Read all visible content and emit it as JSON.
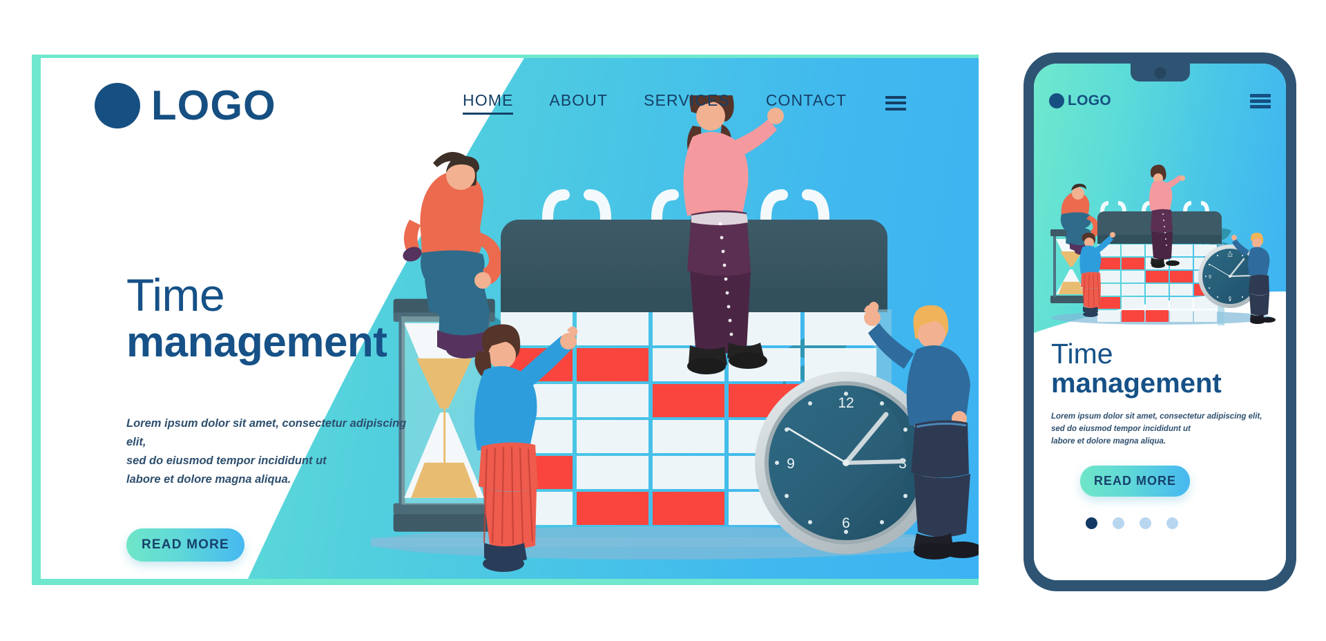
{
  "brand": {
    "logo_text": "LOGO",
    "logo_icon": "circle-dot-icon"
  },
  "nav": {
    "items": [
      {
        "label": "HOME",
        "active": true
      },
      {
        "label": "ABOUT",
        "active": false
      },
      {
        "label": "SERVICES",
        "active": false
      },
      {
        "label": "CONTACT",
        "active": false
      }
    ],
    "menu_icon": "hamburger-icon"
  },
  "hero": {
    "title_line1": "Time",
    "title_line2": "management",
    "description": "Lorem ipsum dolor sit amet, consectetur adipiscing elit,\nsed do eiusmod tempor incididunt ut\nlabore et dolore magna aliqua.",
    "desc_line1": "Lorem ipsum dolor sit amet, consectetur adipiscing elit,",
    "desc_line2": "sed do eiusmod tempor incididunt ut",
    "desc_line3": "labore et dolore magna aliqua.",
    "cta_label": "READ MORE",
    "carousel_dots": 4,
    "carousel_active_index": 0
  },
  "mobile": {
    "logo_text": "LOGO",
    "menu_icon": "hamburger-icon",
    "title_line1": "Time",
    "title_line2": "management",
    "desc_line1": "Lorem ipsum dolor sit amet, consectetur adipiscing elit,",
    "desc_line2": "sed do eiusmod tempor incididunt ut",
    "desc_line3": "labore et dolore magna aliqua.",
    "cta_label": "READ MORE",
    "carousel_dots": 4,
    "carousel_active_index": 0
  },
  "illustration": {
    "clock_numerals": [
      "12",
      "3",
      "6",
      "9"
    ],
    "calendar_columns": 5,
    "calendar_rows": 6,
    "calendar_highlight_color": "#f9453e",
    "calendar_cell_color": "#eef5f8",
    "calendar_header_color": "#3d5a66",
    "hourglass_sand_color": "#e8bd72"
  },
  "colors": {
    "brand_navy": "#164f81",
    "accent_mint": "#6fe8cd",
    "accent_blue": "#3db2f2",
    "frame_border": "#6fe8cd",
    "phone_bezel": "#2f5473",
    "dot_inactive": "#b9d6ef",
    "dot_active": "#123a63"
  }
}
